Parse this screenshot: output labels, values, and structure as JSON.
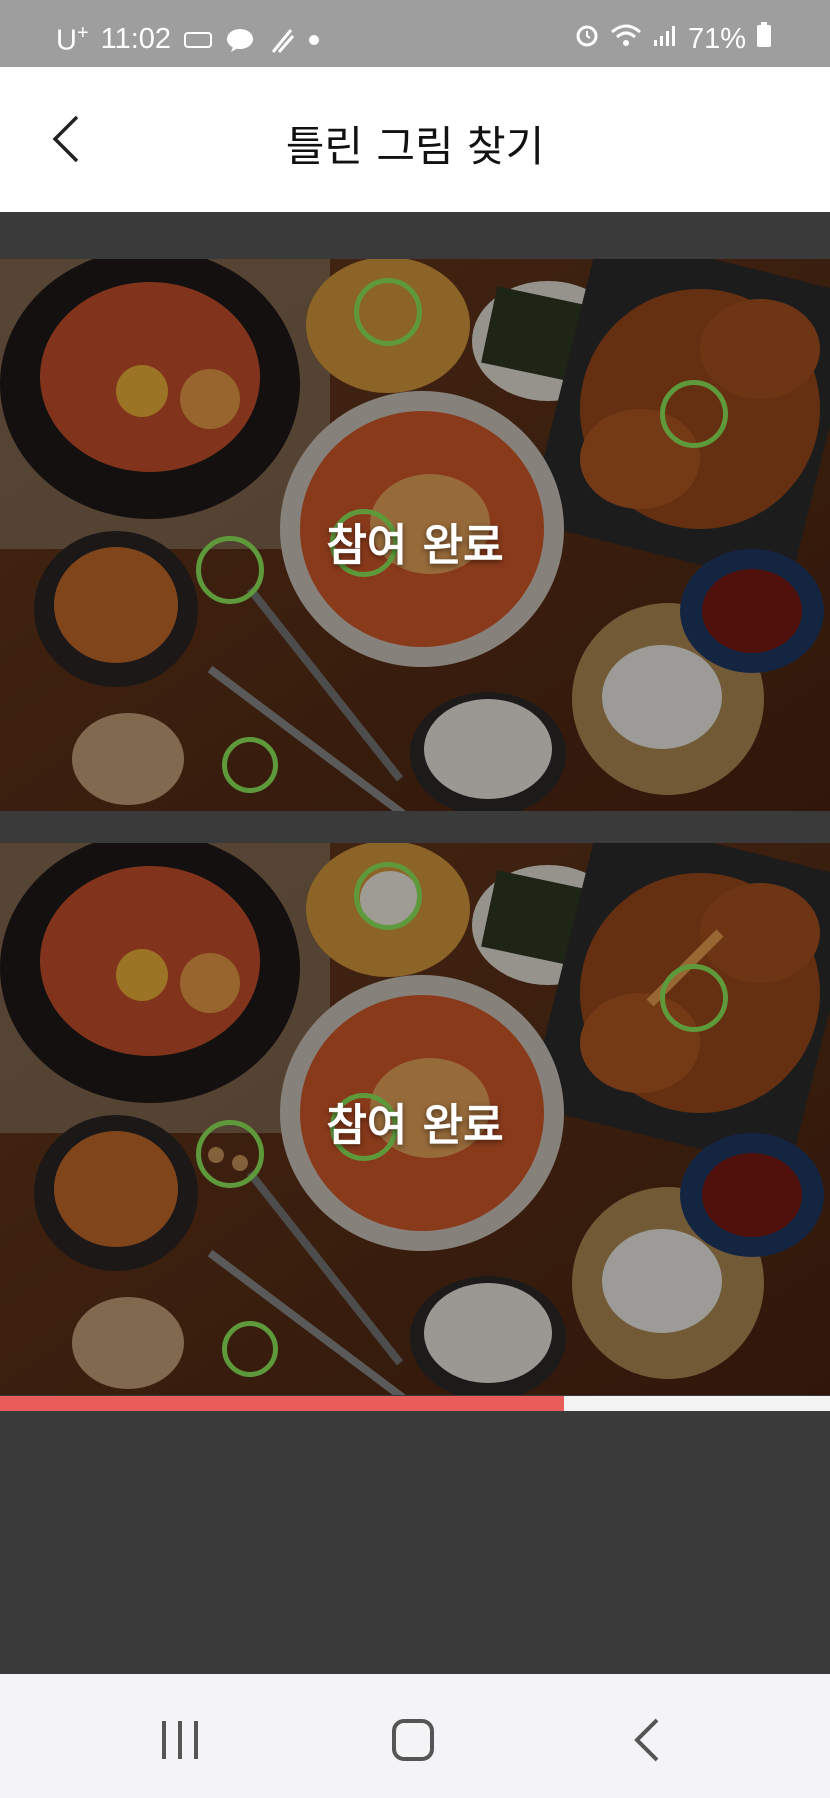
{
  "status": {
    "carrier": "U",
    "carrier_sup": "+",
    "time": "11:02",
    "battery": "71%"
  },
  "header": {
    "title": "틀린 그림 찾기"
  },
  "game": {
    "top_overlay": "참여 완료",
    "bottom_overlay": "참여 완료",
    "progress_fraction": 0.68
  },
  "colors": {
    "accent": "#e85c5a",
    "marker": "#5e9a3c"
  },
  "icons": {
    "back": "chevron-left-icon",
    "recent": "recent-apps-icon",
    "home": "home-icon",
    "nav_back": "nav-back-icon"
  }
}
